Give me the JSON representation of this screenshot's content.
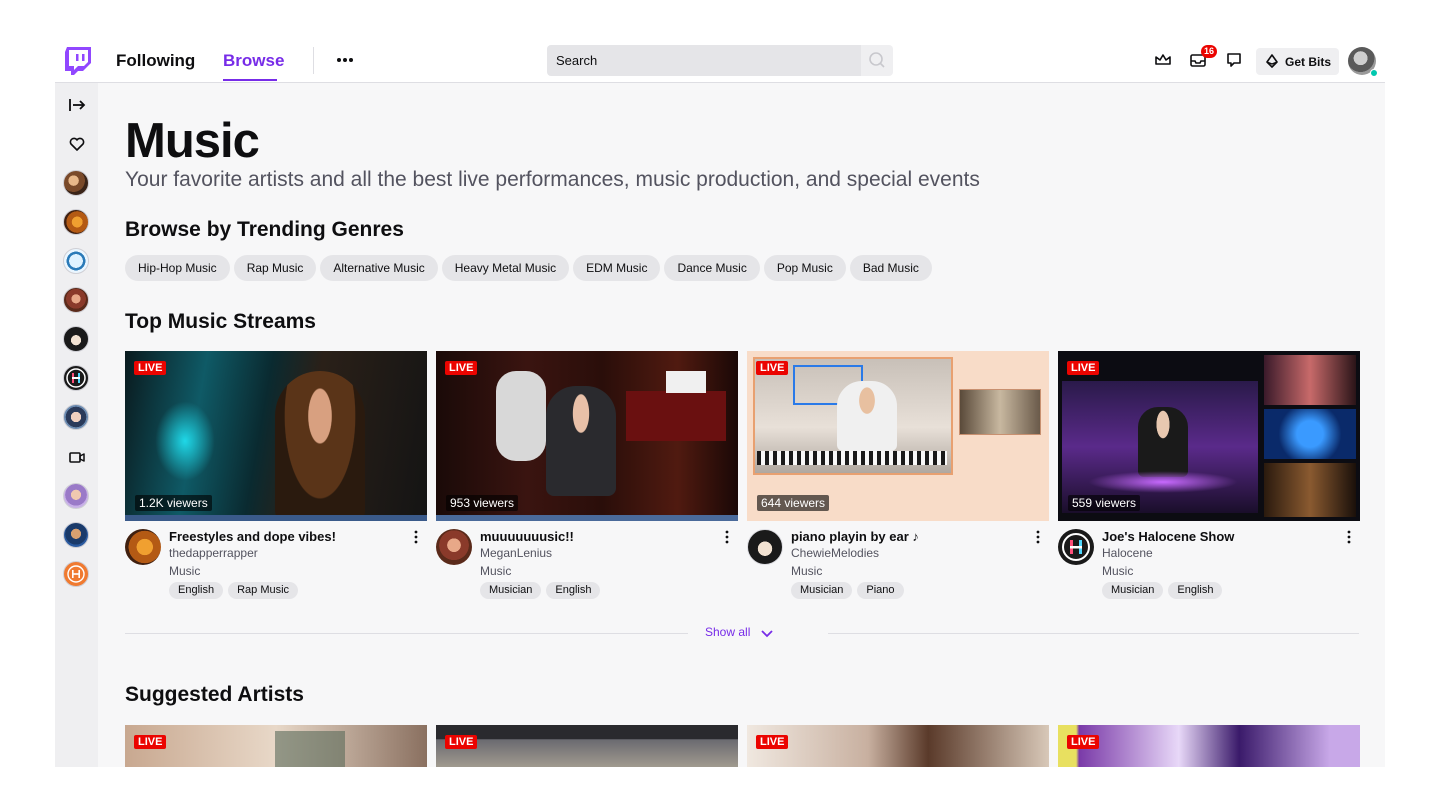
{
  "nav": {
    "following": "Following",
    "browse": "Browse",
    "search_placeholder": "Search",
    "notification_count": "16",
    "get_bits": "Get Bits"
  },
  "colors": {
    "brand": "#772ce8",
    "live": "#eb0400",
    "online": "#00c8af"
  },
  "sidebar": {
    "items": [
      {
        "type": "icon",
        "icon": "collapse-arrow-icon"
      },
      {
        "type": "icon",
        "icon": "heart-icon"
      },
      {
        "type": "avatar",
        "name": "followed-channel-1"
      },
      {
        "type": "avatar",
        "name": "followed-channel-2"
      },
      {
        "type": "avatar",
        "name": "followed-channel-3"
      },
      {
        "type": "avatar",
        "name": "followed-channel-4"
      },
      {
        "type": "avatar",
        "name": "followed-channel-5"
      },
      {
        "type": "avatar",
        "name": "followed-channel-6"
      },
      {
        "type": "avatar",
        "name": "followed-channel-7"
      },
      {
        "type": "icon",
        "icon": "video-camera-icon"
      },
      {
        "type": "avatar",
        "name": "recommended-channel-1"
      },
      {
        "type": "avatar",
        "name": "recommended-channel-2"
      },
      {
        "type": "avatar",
        "name": "recommended-channel-3"
      }
    ]
  },
  "page": {
    "title": "Music",
    "subtitle": "Your favorite artists and all the best live performances, music production, and special events"
  },
  "genres": {
    "heading": "Browse by Trending Genres",
    "items": [
      "Hip-Hop Music",
      "Rap Music",
      "Alternative Music",
      "Heavy Metal Music",
      "EDM Music",
      "Dance Music",
      "Pop Music",
      "Bad Music"
    ]
  },
  "streams": {
    "heading": "Top Music Streams",
    "items": [
      {
        "live": "LIVE",
        "viewers": "1.2K viewers",
        "title": "Freestyles and dope vibes!",
        "channel": "thedapperrapper",
        "category": "Music",
        "tags": [
          "English",
          "Rap Music"
        ]
      },
      {
        "live": "LIVE",
        "viewers": "953 viewers",
        "title": "muuuuuuusic!!",
        "channel": "MeganLenius",
        "category": "Music",
        "tags": [
          "Musician",
          "English"
        ]
      },
      {
        "live": "LIVE",
        "viewers": "644 viewers",
        "title": "piano playin by ear ♪",
        "channel": "ChewieMelodies",
        "category": "Music",
        "tags": [
          "Musician",
          "Piano"
        ]
      },
      {
        "live": "LIVE",
        "viewers": "559 viewers",
        "title": "Joe's Halocene Show",
        "channel": "Halocene",
        "category": "Music",
        "tags": [
          "Musician",
          "English"
        ]
      }
    ],
    "show_all": "Show all"
  },
  "artists": {
    "heading": "Suggested Artists",
    "items": [
      {
        "live": "LIVE"
      },
      {
        "live": "LIVE"
      },
      {
        "live": "LIVE"
      },
      {
        "live": "LIVE"
      }
    ]
  }
}
